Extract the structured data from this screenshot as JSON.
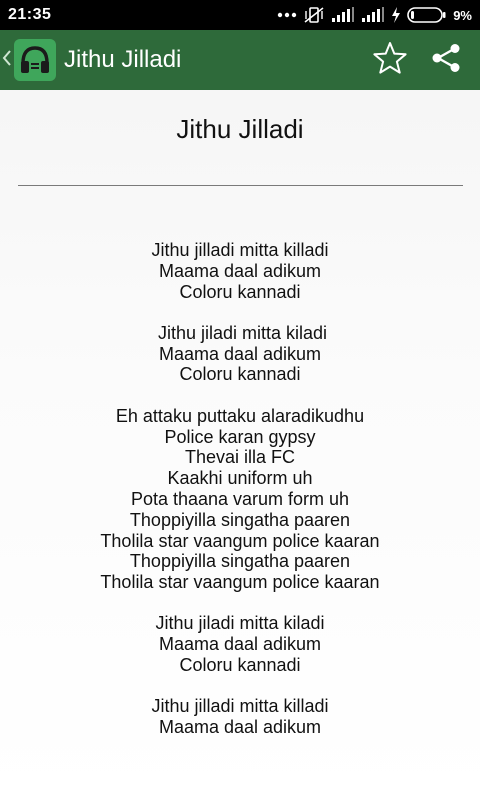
{
  "status_bar": {
    "time": "21:35",
    "battery_percent": "9%"
  },
  "app_bar": {
    "back_icon": "chevron-left-icon",
    "app_icon": "headphones-icon",
    "title": "Jithu Jilladi",
    "actions": [
      "star-icon",
      "share-icon"
    ]
  },
  "song": {
    "title": "Jithu Jilladi",
    "stanzas": [
      [
        "Jithu jilladi mitta killadi",
        "Maama daal adikum",
        "Coloru kannadi"
      ],
      [
        " Jithu jiladi mitta kiladi",
        "Maama daal adikum",
        "Coloru kannadi"
      ],
      [
        "Eh attaku puttaku alaradikudhu",
        "Police karan gypsy",
        "Thevai illa FC",
        "Kaakhi uniform uh",
        "Pota thaana varum form uh",
        "Thoppiyilla singatha paaren",
        "Tholila star vaangum police kaaran",
        "Thoppiyilla singatha paaren",
        "Tholila star vaangum police kaaran"
      ],
      [
        "Jithu jiladi mitta kiladi",
        "Maama daal adikum",
        "Coloru kannadi"
      ],
      [
        "Jithu jilladi mitta killadi",
        "Maama daal adikum"
      ]
    ]
  },
  "colors": {
    "app_bar": "#2e6a3a",
    "app_icon": "#3fa65b",
    "status_bar": "#000000"
  }
}
